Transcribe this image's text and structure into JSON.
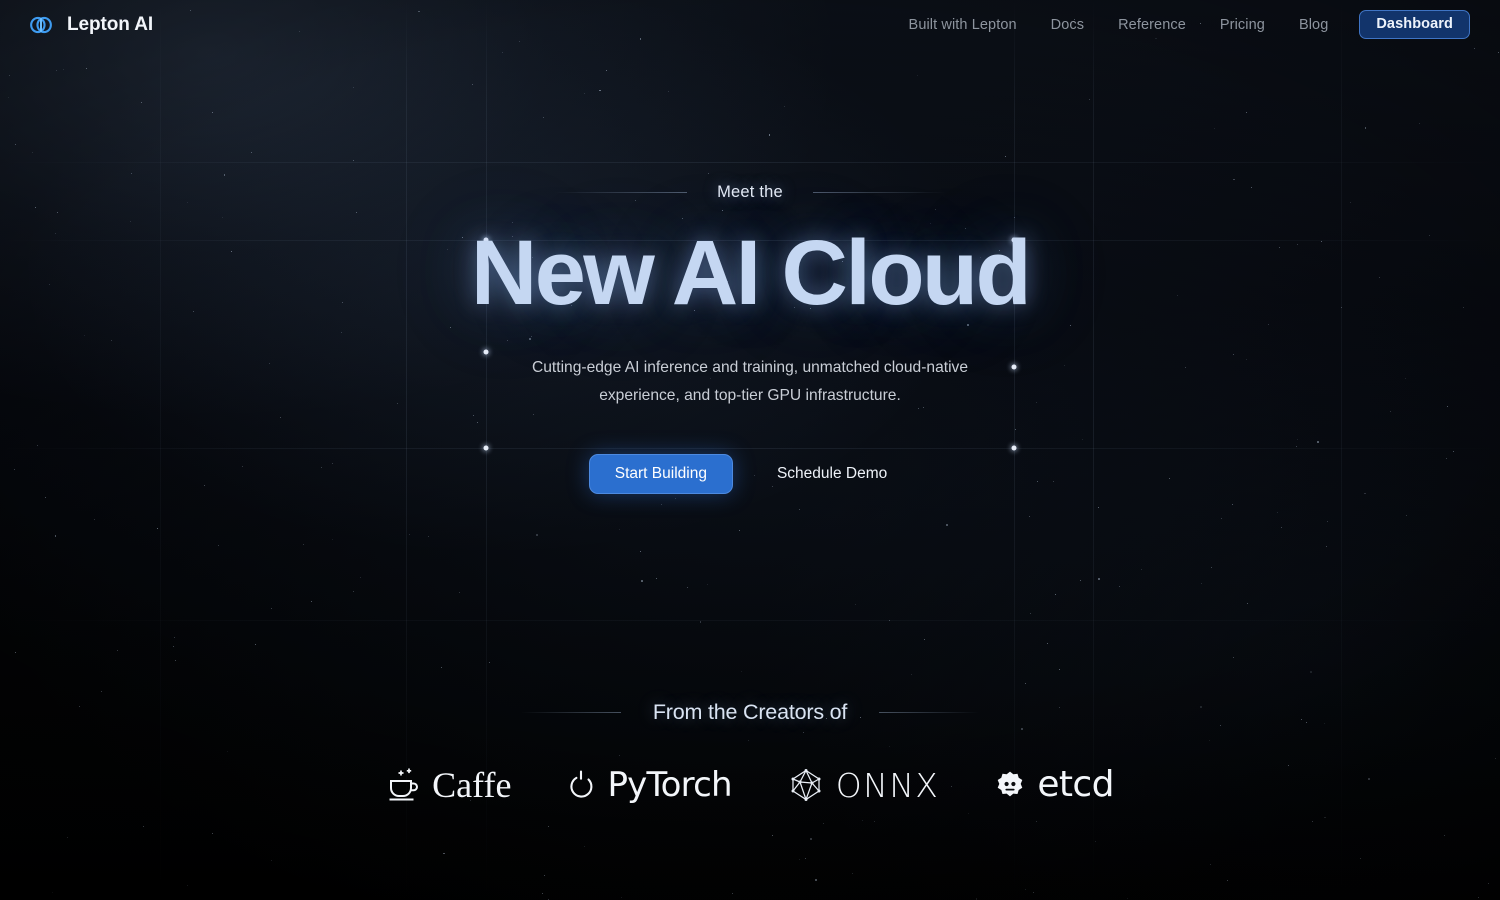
{
  "brand": {
    "name": "Lepton AI",
    "logo_icon": "lepton-double-circle-icon"
  },
  "header": {
    "nav": [
      {
        "label": "Built with Lepton"
      },
      {
        "label": "Docs"
      },
      {
        "label": "Reference"
      },
      {
        "label": "Pricing"
      },
      {
        "label": "Blog"
      }
    ],
    "dashboard_label": "Dashboard"
  },
  "hero": {
    "eyebrow": "Meet the",
    "headline": "New AI Cloud",
    "subtitle": "Cutting-edge AI inference and training, unmatched cloud-native experience, and top-tier GPU infrastructure.",
    "primary_cta": "Start Building",
    "secondary_cta": "Schedule Demo"
  },
  "creators": {
    "title": "From the Creators of",
    "logos": [
      {
        "name": "Caffe",
        "icon": "coffee-cup-icon"
      },
      {
        "name": "PyTorch",
        "icon": "pytorch-flame-icon"
      },
      {
        "name": "ONNX",
        "icon": "onnx-polyhedron-icon"
      },
      {
        "name": "etcd",
        "icon": "etcd-gear-icon"
      }
    ]
  },
  "colors": {
    "accent_blue": "#2b6fcf",
    "dashboard_bg": "#12346b",
    "dashboard_border": "#3f74c4",
    "headline": "#c5d7f2",
    "background": "#010104",
    "nav_text": "#8d949e"
  }
}
